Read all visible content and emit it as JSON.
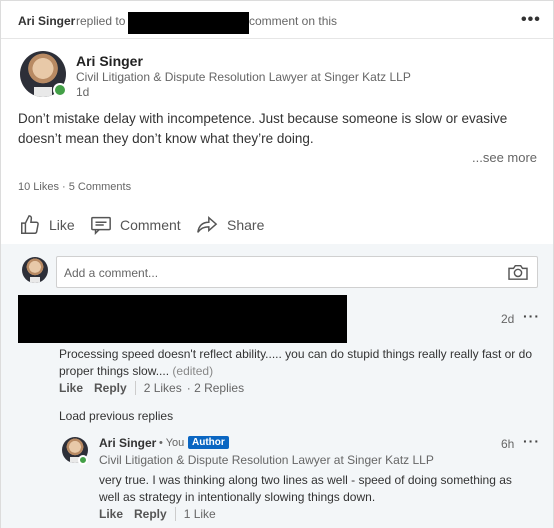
{
  "header": {
    "actor": "Ari Singer",
    "action_pre": "replied to",
    "action_post": "comment on this"
  },
  "post": {
    "author_name": "Ari Singer",
    "author_title": "Civil Litigation & Dispute Resolution Lawyer at Singer Katz LLP",
    "time": "1d",
    "text": "Don’t  mistake delay with incompetence. Just because someone is slow or evasive doesn’t mean they don’t know what they’re doing.",
    "see_more": "...see more",
    "counts": "10 Likes · 5 Comments"
  },
  "actions": {
    "like": "Like",
    "comment": "Comment",
    "share": "Share"
  },
  "comment_input": {
    "placeholder": "Add a comment..."
  },
  "comment": {
    "time": "2d",
    "text": "Processing speed doesn't reflect ability..... you can do stupid things really really fast or do proper things slow....",
    "edited": "(edited)",
    "like": "Like",
    "reply": "Reply",
    "likes": "2 Likes",
    "replies": "2 Replies"
  },
  "load_previous": "Load previous replies",
  "reply": {
    "author_name": "Ari Singer",
    "you": "• You",
    "badge": "Author",
    "time": "6h",
    "author_title": "Civil Litigation & Dispute Resolution Lawyer at Singer Katz LLP",
    "text": "very true. I was thinking along two lines as well - speed of doing something as well as strategy in intentionally slowing things down.",
    "like": "Like",
    "reply": "Reply",
    "likes": "1 Like"
  },
  "colors": {
    "presence": "#43a047",
    "author_badge": "#0a66c2",
    "comments_bg": "#f3f6f8"
  }
}
